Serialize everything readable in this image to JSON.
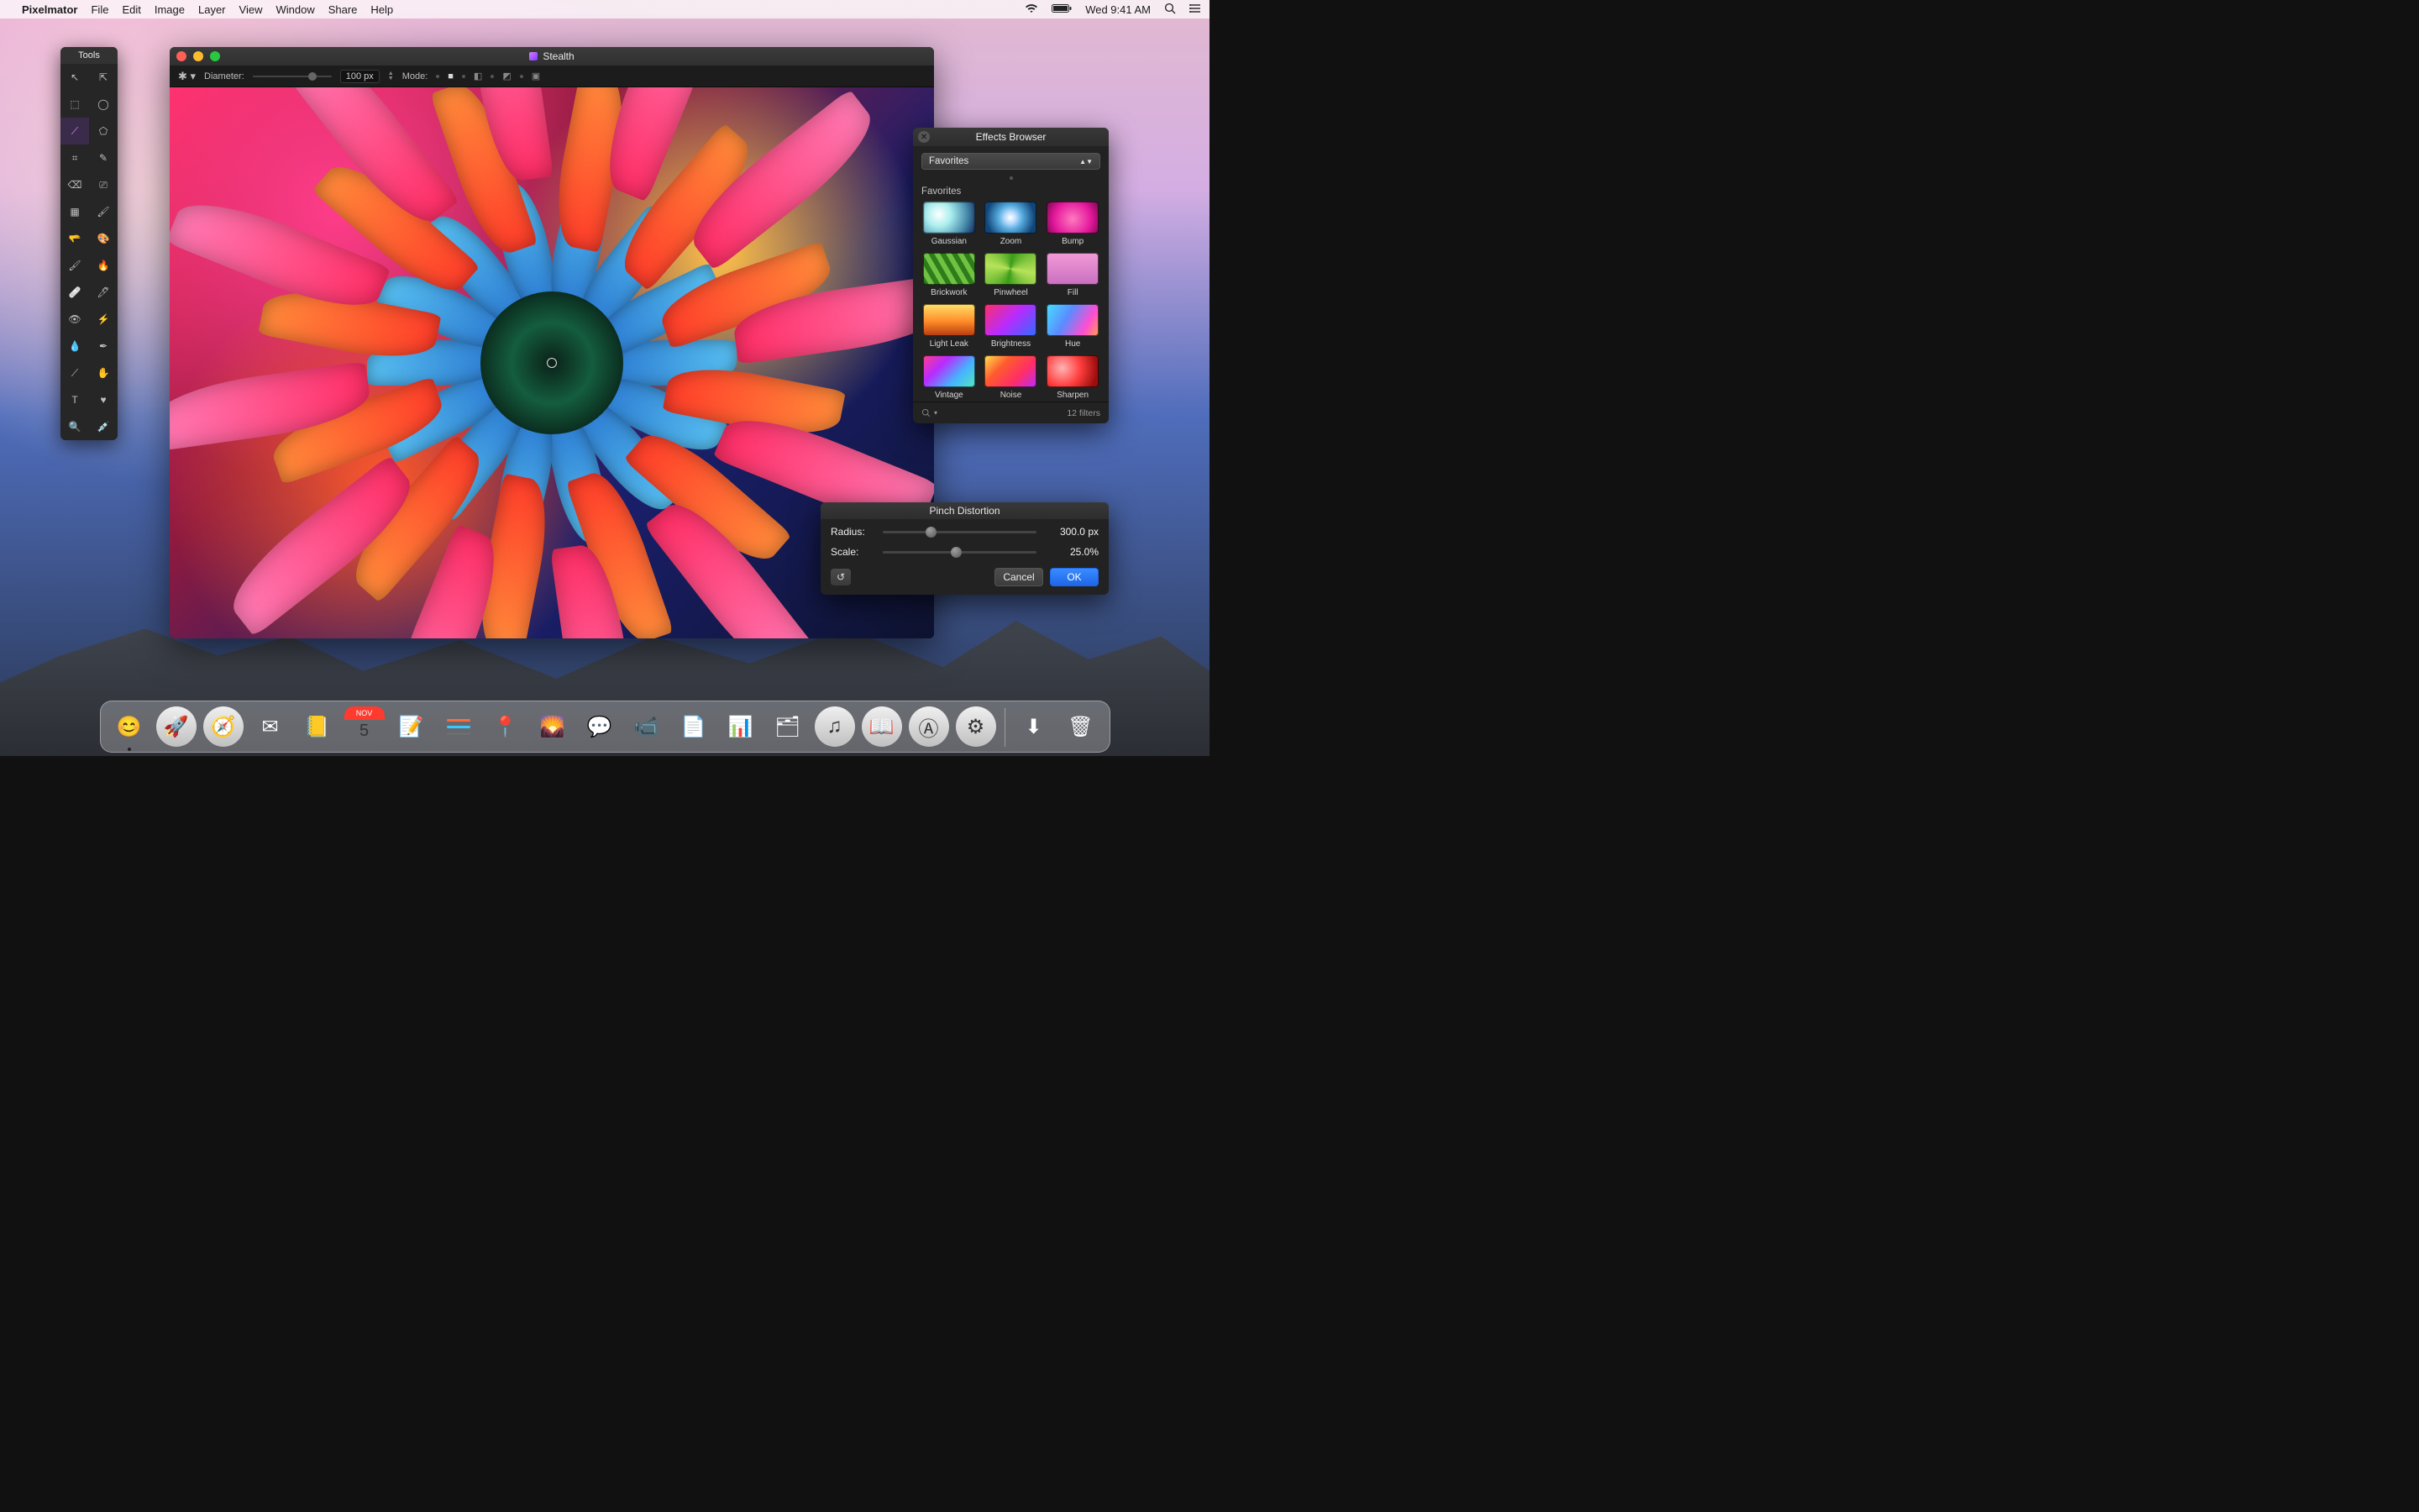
{
  "menubar": {
    "app_name": "Pixelmator",
    "items": [
      "File",
      "Edit",
      "Image",
      "Layer",
      "View",
      "Window",
      "Share",
      "Help"
    ],
    "clock": "Wed 9:41 AM"
  },
  "tools_palette": {
    "title": "Tools",
    "tools": [
      "move-tool",
      "transform-tool",
      "rect-marquee-tool",
      "ellipse-marquee-tool",
      "lasso-tool",
      "polygonal-lasso-tool",
      "crop-tool",
      "magic-wand-tool",
      "eraser-tool",
      "paint-bucket-tool",
      "gradient-tool",
      "brush-tool",
      "smudge-tool",
      "color-picker-tool",
      "clone-tool",
      "sponge-tool",
      "healing-tool",
      "pixel-tool",
      "red-eye-tool",
      "sharpen-tool",
      "blur-tool",
      "pen-tool",
      "slice-tool",
      "hand-tool",
      "type-tool",
      "shape-tool",
      "zoom-tool",
      "eyedropper-tool"
    ],
    "selected_index": 4
  },
  "document": {
    "title": "Stealth",
    "options_bar": {
      "diameter_label": "Diameter:",
      "diameter_value": "100 px",
      "mode_label": "Mode:"
    }
  },
  "effects_browser": {
    "title": "Effects Browser",
    "category": "Favorites",
    "section_label": "Favorites",
    "items": [
      {
        "name": "Gaussian",
        "thumb": "th-gaussian"
      },
      {
        "name": "Zoom",
        "thumb": "th-zoom"
      },
      {
        "name": "Bump",
        "thumb": "th-bump"
      },
      {
        "name": "Brickwork",
        "thumb": "th-brickwork"
      },
      {
        "name": "Pinwheel",
        "thumb": "th-pinwheel"
      },
      {
        "name": "Fill",
        "thumb": "th-fill"
      },
      {
        "name": "Light Leak",
        "thumb": "th-lightleak"
      },
      {
        "name": "Brightness",
        "thumb": "th-brightness"
      },
      {
        "name": "Hue",
        "thumb": "th-hue"
      },
      {
        "name": "Vintage",
        "thumb": "th-vintage"
      },
      {
        "name": "Noise",
        "thumb": "th-noise"
      },
      {
        "name": "Sharpen",
        "thumb": "th-sharpen"
      }
    ],
    "count_label": "12 filters"
  },
  "pinch_panel": {
    "title": "Pinch Distortion",
    "radius_label": "Radius:",
    "radius_value": "300.0 px",
    "radius_pos_pct": 28,
    "scale_label": "Scale:",
    "scale_value": "25.0%",
    "scale_pos_pct": 44,
    "cancel": "Cancel",
    "ok": "OK"
  },
  "dock": {
    "calendar_month": "NOV",
    "calendar_day": "5",
    "apps": [
      {
        "id": "finder",
        "name": "finder-app",
        "shape": "tile",
        "cls": "d-finder",
        "glyph": "😊",
        "indicator": true
      },
      {
        "id": "launchpad",
        "name": "launchpad-app",
        "shape": "circle",
        "cls": "d-launchpad",
        "glyph": "🚀"
      },
      {
        "id": "safari",
        "name": "safari-app",
        "shape": "circle",
        "cls": "d-safari",
        "glyph": "🧭"
      },
      {
        "id": "mail",
        "name": "mail-app",
        "shape": "tile",
        "cls": "d-mail",
        "glyph": "✉︎"
      },
      {
        "id": "contacts",
        "name": "contacts-app",
        "shape": "tile",
        "cls": "d-contacts",
        "glyph": "📒"
      },
      {
        "id": "calendar",
        "name": "calendar-app",
        "shape": "tile",
        "cls": "d-cal",
        "glyph": ""
      },
      {
        "id": "notes",
        "name": "notes-app",
        "shape": "tile",
        "cls": "d-notes",
        "glyph": "📝"
      },
      {
        "id": "reminders",
        "name": "reminders-app",
        "shape": "tile",
        "cls": "d-reminders",
        "glyph": ""
      },
      {
        "id": "maps",
        "name": "maps-app",
        "shape": "tile",
        "cls": "d-maps",
        "glyph": "📍"
      },
      {
        "id": "photos",
        "name": "photos-app",
        "shape": "tile",
        "cls": "d-photos",
        "glyph": "🌄"
      },
      {
        "id": "messages",
        "name": "messages-app",
        "shape": "tile",
        "cls": "d-messages",
        "glyph": "💬"
      },
      {
        "id": "facetime",
        "name": "facetime-app",
        "shape": "tile",
        "cls": "d-facetime",
        "glyph": "📹"
      },
      {
        "id": "pages",
        "name": "pages-app",
        "shape": "tile",
        "cls": "d-pages",
        "glyph": "📄"
      },
      {
        "id": "numbers",
        "name": "numbers-app",
        "shape": "tile",
        "cls": "d-numbers",
        "glyph": "📊"
      },
      {
        "id": "keynote",
        "name": "keynote-app",
        "shape": "tile",
        "cls": "d-keynote",
        "glyph": "🗂"
      },
      {
        "id": "itunes",
        "name": "itunes-app",
        "shape": "circle",
        "cls": "d-itunes",
        "glyph": "♫"
      },
      {
        "id": "ibooks",
        "name": "ibooks-app",
        "shape": "circle",
        "cls": "d-ibooks",
        "glyph": "📖"
      },
      {
        "id": "appstore",
        "name": "appstore-app",
        "shape": "circle",
        "cls": "d-appstore",
        "glyph": "Ⓐ"
      },
      {
        "id": "prefs",
        "name": "system-prefs-app",
        "shape": "circle",
        "cls": "d-prefs",
        "glyph": "⚙︎"
      }
    ],
    "right": [
      {
        "id": "downloads",
        "name": "downloads-stack",
        "shape": "tile",
        "cls": "d-downloads",
        "glyph": "⬇︎"
      },
      {
        "id": "trash",
        "name": "trash",
        "shape": "tile",
        "cls": "d-trash",
        "glyph": "🗑"
      }
    ]
  }
}
